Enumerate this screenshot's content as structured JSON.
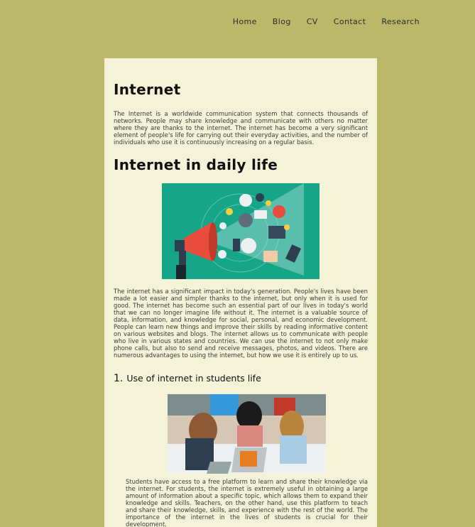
{
  "nav": {
    "items": [
      "Home",
      "Blog",
      "CV",
      "Contact",
      "Research"
    ]
  },
  "article": {
    "title": "Internet",
    "intro": "The Internet is a worldwide communication system that connects thousands of networks. People may share knowledge and communicate with others no matter where they are thanks to the internet. The internet has become a very significant element of people's life for carrying out their everyday activities, and the number of individuals who use it is continuously increasing on a regular basis.",
    "section_title": "Internet in daily life",
    "section_text": "The internet has a significant impact in today's generation. People's lives have been made a lot easier and simpler thanks to the internet, but only when it is used for good. The internet has become such an essential part of our lives in today's world that we can no longer imagine life without it. The internet is a valuable source of data, information, and knowledge for social, personal, and economic development. People can learn new things and improve their skills by reading informative content on various websites and blogs. The internet allows us to communicate with people who live in various states and countries. We can use the internet to not only make phone calls, but also to send and receive messages, photos, and videos. There are numerous advantages to using the internet, but how we use it is entirely up to us.",
    "list_number": "1.",
    "list_title": "Use of internet in students life",
    "list_text": "Students have access to a free platform to learn and share their knowledge via the internet. For students, the internet is extremely useful in obtaining a large amount of information about a specific topic, which allows them to expand their knowledge and skills. Teachers, on the other hand, use this platform to teach and share their knowledge, skills, and experience with the rest of the world. The importance of the internet in the lives of students is crucial for their development."
  },
  "colors": {
    "page_bg": "#bcb86a",
    "card_bg": "#f4f3d8",
    "image_teal": "#17a589"
  }
}
